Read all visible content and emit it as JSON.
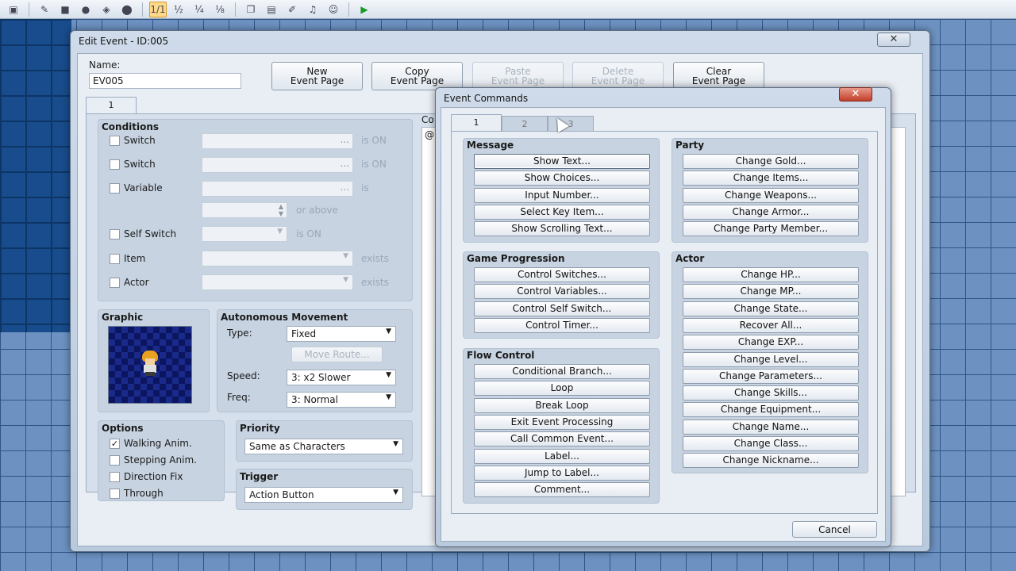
{
  "toolbar": {
    "icons": [
      "map-icon",
      "pencil-icon",
      "rectangle-icon",
      "ellipse-icon",
      "fill-icon",
      "shadow-pen-icon",
      "zoom-1-icon",
      "zoom-half-icon",
      "zoom-quarter-icon",
      "zoom-eighth-icon",
      "resource-manager-icon",
      "database-icon",
      "script-editor-icon",
      "sound-test-icon",
      "character-generator-icon",
      "playtest-icon"
    ],
    "zoom_labels": [
      "1/1",
      "½",
      "¼",
      "⅛"
    ]
  },
  "edit_event": {
    "title": "Edit Event - ID:005",
    "name_label": "Name:",
    "name_value": "EV005",
    "buttons": {
      "new_page": "New\nEvent Page",
      "copy_page": "Copy\nEvent Page",
      "paste_page": "Paste\nEvent Page",
      "delete_page": "Delete\nEvent Page",
      "clear_page": "Clear\nEvent Page"
    },
    "page_tab": "1",
    "conditions": {
      "title": "Conditions",
      "switch1": "Switch",
      "switch2": "Switch",
      "variable": "Variable",
      "self_switch": "Self Switch",
      "item": "Item",
      "actor": "Actor",
      "is_on": "is ON",
      "is": "is",
      "or_above": "or above",
      "exists": "exists",
      "ellipsis": "..."
    },
    "graphic": {
      "title": "Graphic"
    },
    "movement": {
      "title": "Autonomous Movement",
      "type_label": "Type:",
      "type_value": "Fixed",
      "move_route": "Move Route...",
      "speed_label": "Speed:",
      "speed_value": "3: x2 Slower",
      "freq_label": "Freq:",
      "freq_value": "3: Normal"
    },
    "options": {
      "title": "Options",
      "walking": "Walking Anim.",
      "stepping": "Stepping Anim.",
      "direction_fix": "Direction Fix",
      "through": "Through"
    },
    "priority": {
      "title": "Priority",
      "value": "Same as Characters"
    },
    "trigger": {
      "title": "Trigger",
      "value": "Action Button"
    },
    "contents_label_partial": "Co",
    "contents_at": "@"
  },
  "event_commands": {
    "title": "Event Commands",
    "tabs": [
      "1",
      "2",
      "3"
    ],
    "message": {
      "title": "Message",
      "items": [
        "Show Text...",
        "Show Choices...",
        "Input Number...",
        "Select Key Item...",
        "Show Scrolling Text..."
      ]
    },
    "game_progression": {
      "title": "Game Progression",
      "items": [
        "Control Switches...",
        "Control Variables...",
        "Control Self Switch...",
        "Control Timer..."
      ]
    },
    "flow_control": {
      "title": "Flow Control",
      "items": [
        "Conditional Branch...",
        "Loop",
        "Break Loop",
        "Exit Event Processing",
        "Call Common Event...",
        "Label...",
        "Jump to Label...",
        "Comment..."
      ]
    },
    "party": {
      "title": "Party",
      "items": [
        "Change Gold...",
        "Change Items...",
        "Change Weapons...",
        "Change Armor...",
        "Change Party Member..."
      ]
    },
    "actor": {
      "title": "Actor",
      "items": [
        "Change HP...",
        "Change MP...",
        "Change State...",
        "Recover All...",
        "Change EXP...",
        "Change Level...",
        "Change Parameters...",
        "Change Skills...",
        "Change Equipment...",
        "Change Name...",
        "Change Class...",
        "Change Nickname..."
      ]
    },
    "cancel": "Cancel"
  },
  "colors": {
    "accent": "#ffd98a",
    "close_red": "#c23f2a",
    "map_tile": "#184c8c"
  }
}
